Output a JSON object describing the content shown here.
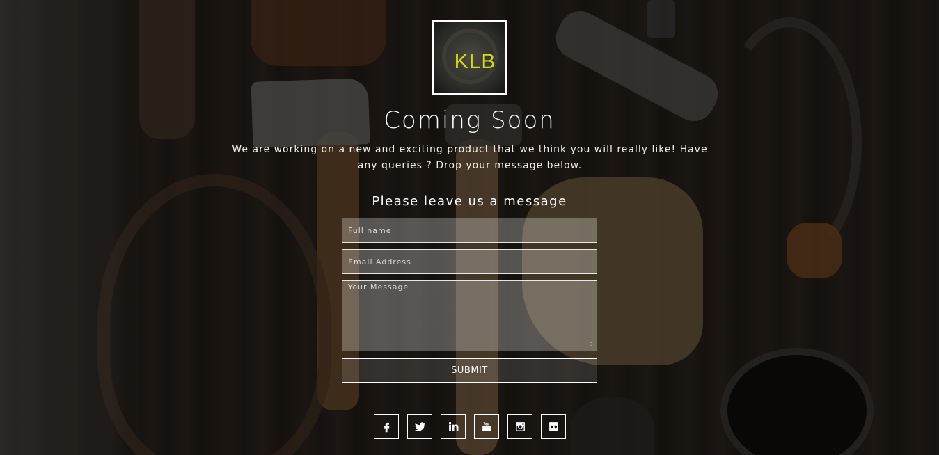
{
  "logo": {
    "text": "KLB",
    "accent": "#d8d71a"
  },
  "hero": {
    "title": "Coming Soon",
    "description": "We are working on a new and exciting product that we think you will really like! Have any queries ? Drop your message below."
  },
  "form": {
    "heading": "Please leave us a message",
    "name_placeholder": "Full name",
    "email_placeholder": "Email Address",
    "message_placeholder": "Your Message",
    "submit_label": "SUBMIT"
  },
  "social": [
    "facebook-icon",
    "twitter-icon",
    "linkedin-icon",
    "youtube-icon",
    "instagram-icon",
    "flickr-icon"
  ]
}
